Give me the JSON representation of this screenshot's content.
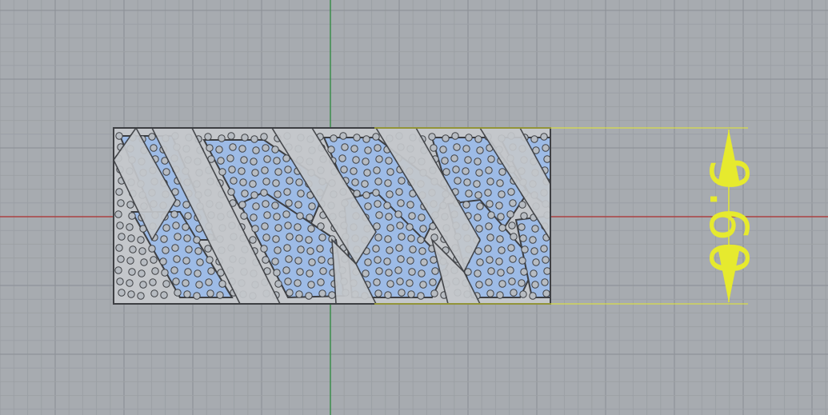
{
  "viewport": {
    "background": "#a7abb0",
    "grid_minor_color": "#9ca0a5",
    "grid_major_color": "#8f9399",
    "x_axis_color": "#b03030",
    "y_axis_color": "#2e8b3e"
  },
  "model": {
    "metal_color": "#c4c7cb",
    "metal_edge_color": "#3d3f43",
    "stone_face_color": "#9dbbe6",
    "gem_color": "#b7bcc2"
  },
  "dimension": {
    "value": "9.60",
    "color": "#e6ea2e",
    "orientation": "vertical"
  }
}
